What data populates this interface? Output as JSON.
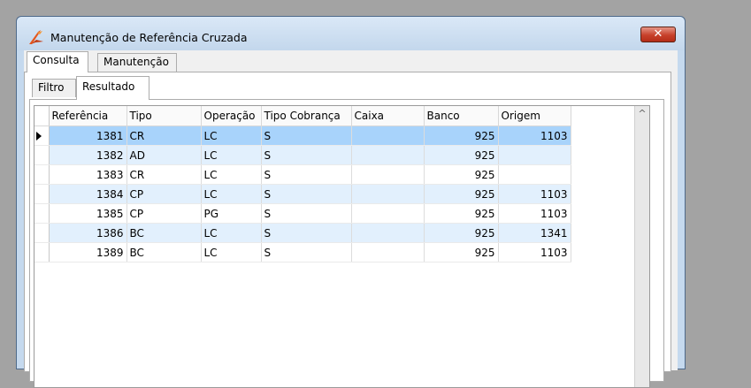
{
  "window": {
    "title": "Manutenção de Referência Cruzada",
    "close_glyph": "✕"
  },
  "outer_tabs": [
    {
      "label": "Consulta",
      "active": true
    },
    {
      "label": "Manutenção",
      "active": false
    }
  ],
  "inner_tabs": [
    {
      "label": "Filtro",
      "active": false
    },
    {
      "label": "Resultado",
      "active": true
    }
  ],
  "grid": {
    "columns": [
      "Referência",
      "Tipo",
      "Operação",
      "Tipo Cobrança",
      "Caixa",
      "Banco",
      "Origem"
    ],
    "rows": [
      {
        "referencia": "1381",
        "tipo": "CR",
        "operacao": "LC",
        "tipo_cobranca": "S",
        "caixa": "",
        "banco": "925",
        "origem": "1103"
      },
      {
        "referencia": "1382",
        "tipo": "AD",
        "operacao": "LC",
        "tipo_cobranca": "S",
        "caixa": "",
        "banco": "925",
        "origem": ""
      },
      {
        "referencia": "1383",
        "tipo": "CR",
        "operacao": "LC",
        "tipo_cobranca": "S",
        "caixa": "",
        "banco": "925",
        "origem": ""
      },
      {
        "referencia": "1384",
        "tipo": "CP",
        "operacao": "LC",
        "tipo_cobranca": "S",
        "caixa": "",
        "banco": "925",
        "origem": "1103"
      },
      {
        "referencia": "1385",
        "tipo": "CP",
        "operacao": "PG",
        "tipo_cobranca": "S",
        "caixa": "",
        "banco": "925",
        "origem": "1103"
      },
      {
        "referencia": "1386",
        "tipo": "BC",
        "operacao": "LC",
        "tipo_cobranca": "S",
        "caixa": "",
        "banco": "925",
        "origem": "1341"
      },
      {
        "referencia": "1389",
        "tipo": "BC",
        "operacao": "LC",
        "tipo_cobranca": "S",
        "caixa": "",
        "banco": "925",
        "origem": "1103"
      }
    ],
    "selected_row": 0,
    "scroll_up_glyph": "^"
  },
  "colors": {
    "selected_row": "#a8d3fb",
    "alt_row": "#e2f0fd",
    "close_button": "#c7412b",
    "app_icon_primary": "#e4571e"
  }
}
